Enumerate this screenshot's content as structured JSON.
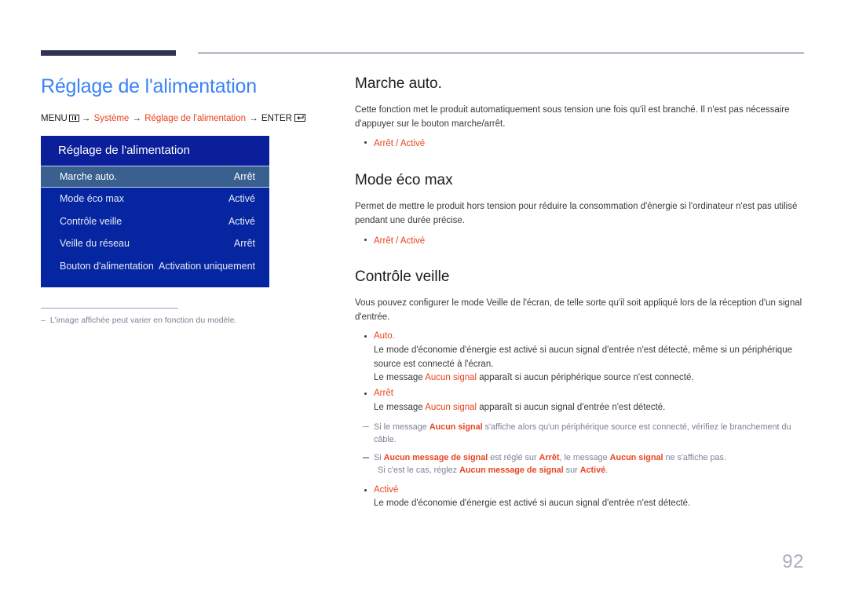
{
  "document": {
    "page_number": "92"
  },
  "left": {
    "title": "Réglage de l'alimentation",
    "breadcrumb": {
      "menu_label": "MENU",
      "menu_icon": "menu-grid-icon",
      "arrow": "→",
      "item1": "Système",
      "item2": "Réglage de l'alimentation",
      "enter_label": "ENTER",
      "enter_icon": "enter-key-icon"
    },
    "osd": {
      "header": "Réglage de l'alimentation",
      "rows": [
        {
          "label": "Marche auto.",
          "value": "Arrêt",
          "selected": true
        },
        {
          "label": "Mode éco max",
          "value": "Activé",
          "selected": false
        },
        {
          "label": "Contrôle veille",
          "value": "Activé",
          "selected": false
        },
        {
          "label": "Veille du réseau",
          "value": "Arrêt",
          "selected": false
        },
        {
          "label": "Bouton d'alimentation",
          "value": "Activation uniquement",
          "selected": false
        }
      ]
    },
    "note": {
      "dash": "–",
      "text": "L'image affichée peut varier en fonction du modèle."
    }
  },
  "right": {
    "section1": {
      "heading": "Marche auto.",
      "paragraph": "Cette fonction met le produit automatiquement sous tension une fois qu'il est branché. Il n'est pas nécessaire d'appuyer sur le bouton marche/arrêt.",
      "option_off": "Arrêt",
      "option_sep": "/",
      "option_on": "Activé"
    },
    "section2": {
      "heading": "Mode éco max",
      "paragraph": "Permet de mettre le produit hors tension pour réduire la consommation d'énergie si l'ordinateur n'est pas utilisé pendant une durée précise.",
      "option_off": "Arrêt",
      "option_sep": "/",
      "option_on": "Activé"
    },
    "section3": {
      "heading": "Contrôle veille",
      "paragraph": "Vous pouvez configurer le mode Veille de l'écran, de telle sorte qu'il soit appliqué lors de la réception d'un signal d'entrée.",
      "auto": {
        "label": "Auto.",
        "body1": "Le mode d'économie d'énergie est activé si aucun signal d'entrée n'est détecté, même si un périphérique source est connecté à l'écran.",
        "body2_pre": "Le message ",
        "body2_accent": "Aucun signal",
        "body2_post": " apparaît si aucun périphérique source n'est connecté."
      },
      "off": {
        "label": "Arrêt",
        "body_pre": "Le message ",
        "body_accent": "Aucun signal",
        "body_post": " apparaît si aucun signal d'entrée n'est détecté."
      },
      "subnotes": [
        {
          "pre": "Si le message ",
          "accent1": "Aucun signal",
          "mid": " s'affiche alors qu'un périphérique source est connecté, vérifiez le branchement du câble."
        },
        {
          "pre": "Si ",
          "accent1": "Aucun message de signal",
          "mid1": " est réglé sur ",
          "accent2": "Arrêt",
          "mid2": ", le message ",
          "accent3": "Aucun signal",
          "post": " ne s'affiche pas.",
          "line2_pre": "Si c'est le cas, réglez ",
          "line2_accent1": "Aucun message de signal",
          "line2_mid": " sur ",
          "line2_accent2": "Activé",
          "line2_post": "."
        }
      ],
      "on": {
        "label": "Activé",
        "body": "Le mode d'économie d'énergie est activé si aucun signal d'entrée n'est détecté."
      }
    }
  }
}
